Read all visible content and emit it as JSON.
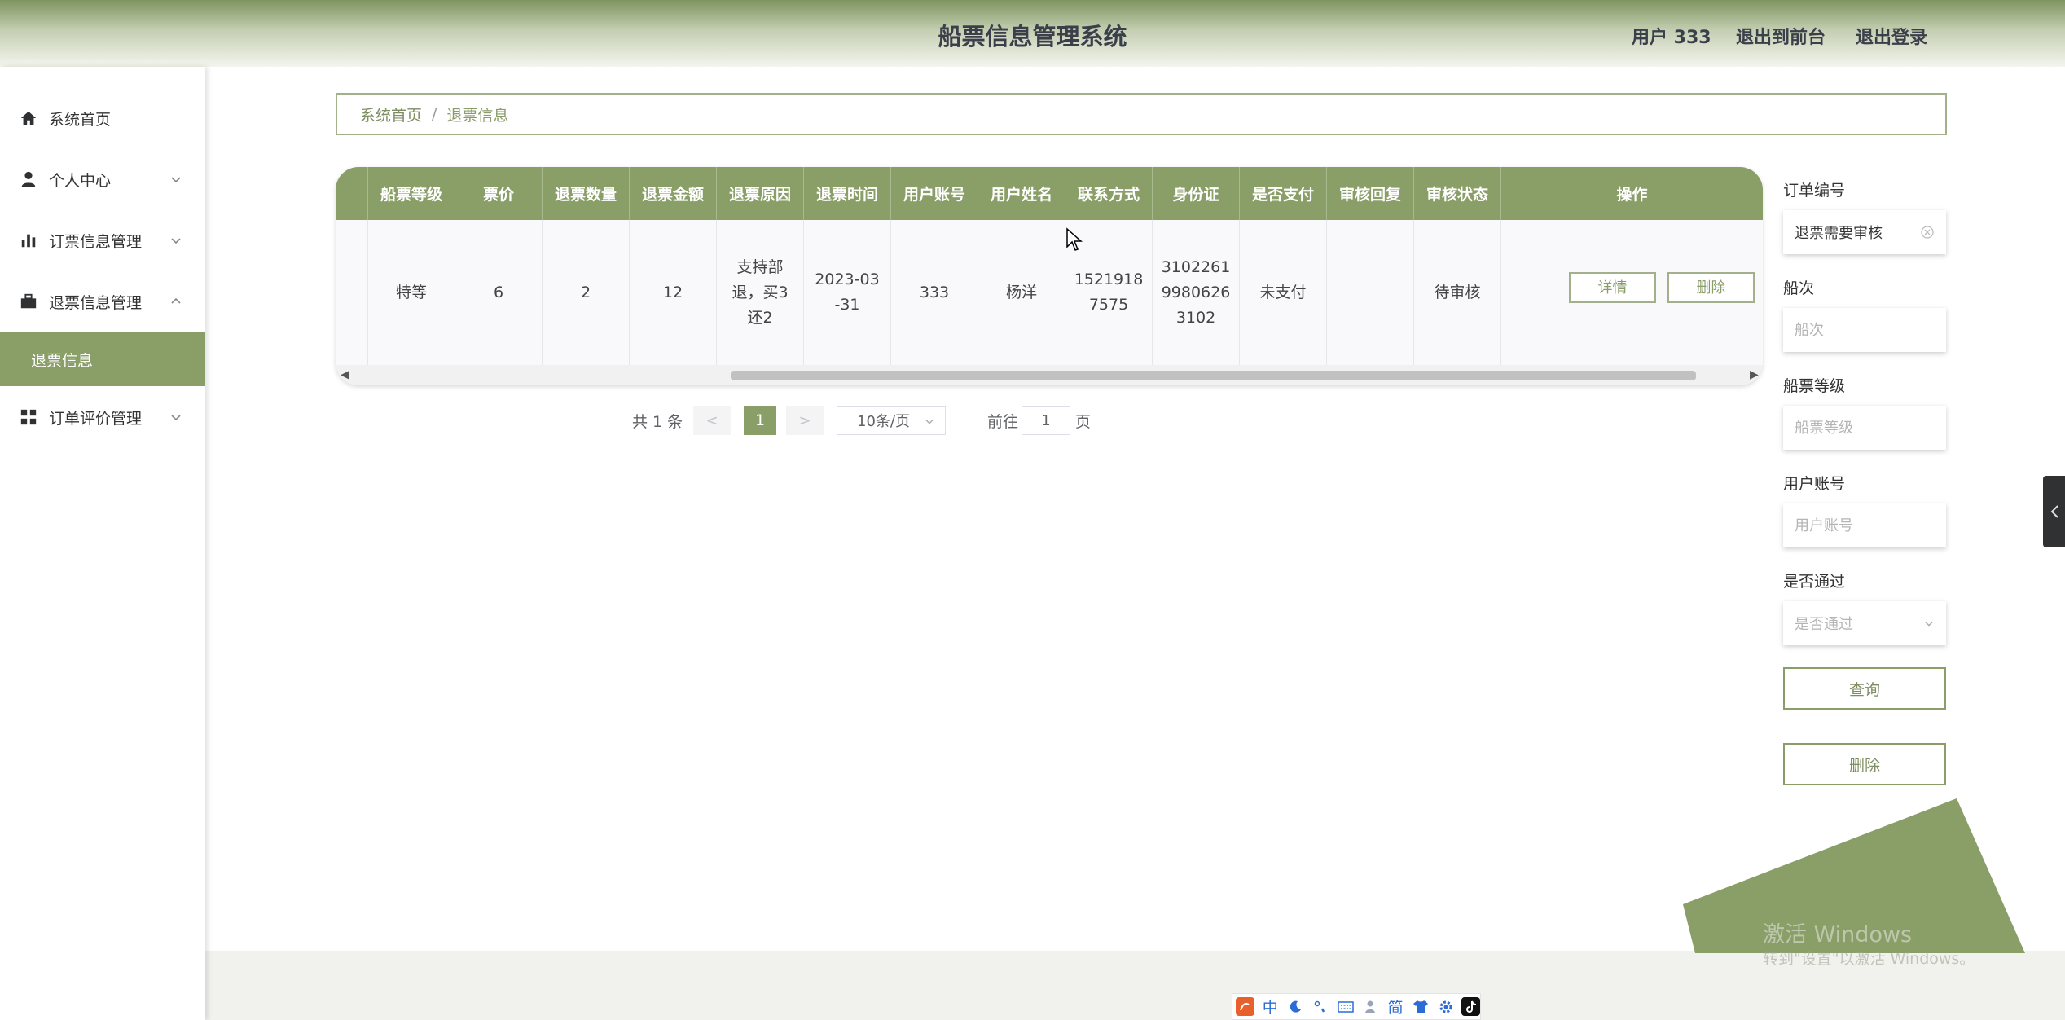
{
  "header": {
    "title": "船票信息管理系统",
    "user": "用户 333",
    "front": "退出到前台",
    "logout": "退出登录"
  },
  "sidebar": {
    "items": [
      {
        "label": "系统首页"
      },
      {
        "label": "个人中心"
      },
      {
        "label": "订票信息管理"
      },
      {
        "label": "退票信息管理"
      },
      {
        "label": "退票信息"
      },
      {
        "label": "订单评价管理"
      }
    ]
  },
  "breadcrumb": {
    "home": "系统首页",
    "sep": "/",
    "current": "退票信息"
  },
  "table": {
    "columns": [
      "船票等级",
      "票价",
      "退票数量",
      "退票金额",
      "退票原因",
      "退票时间",
      "用户账号",
      "用户姓名",
      "联系方式",
      "身份证",
      "是否支付",
      "审核回复",
      "审核状态",
      "操作"
    ],
    "rows": [
      {
        "level": "特等",
        "price": "6",
        "qty": "2",
        "amount": "12",
        "reason_1": "支持部",
        "reason_2": "退，买3",
        "reason_3": "还2",
        "time_1": "2023-03",
        "time_2": "-31",
        "account": "333",
        "name": "杨洋",
        "phone_1": "1521918",
        "phone_2": "7575",
        "id_1": "3102261",
        "id_2": "9980626",
        "id_3": "3102",
        "paid": "未支付",
        "reply": "",
        "status": "待审核",
        "detail": "详情",
        "delete": "删除"
      }
    ]
  },
  "pagination": {
    "total": "共 1 条",
    "prev": "<",
    "page": "1",
    "next": ">",
    "size": "10条/页",
    "goto": "前往",
    "goto_value": "1",
    "unit": "页"
  },
  "search": {
    "order_label": "订单编号",
    "order_value": "退票需要审核",
    "ship_label": "船次",
    "ship_placeholder": "船次",
    "level_label": "船票等级",
    "level_placeholder": "船票等级",
    "account_label": "用户账号",
    "account_placeholder": "用户账号",
    "pass_label": "是否通过",
    "pass_placeholder": "是否通过",
    "query": "查询",
    "delete": "删除"
  },
  "watermark": {
    "line1": "激活 Windows",
    "line2": "转到\"设置\"以激活 Windows。"
  },
  "ime": {
    "zh": "中",
    "simp": "简"
  },
  "colors": {
    "accent": "#8a9e68",
    "header_dark": "#7f9460"
  }
}
